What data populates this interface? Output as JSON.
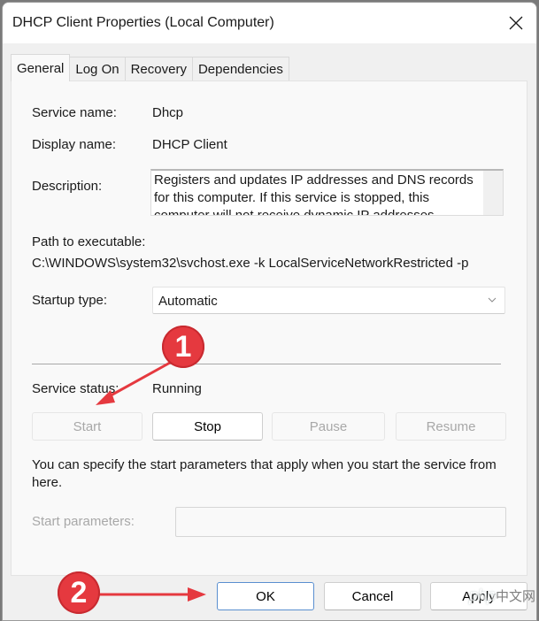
{
  "window": {
    "title": "DHCP Client Properties (Local Computer)"
  },
  "tabs": [
    {
      "label": "General",
      "active": true
    },
    {
      "label": "Log On",
      "active": false
    },
    {
      "label": "Recovery",
      "active": false
    },
    {
      "label": "Dependencies",
      "active": false
    }
  ],
  "general": {
    "service_name_label": "Service name:",
    "service_name_value": "Dhcp",
    "display_name_label": "Display name:",
    "display_name_value": "DHCP Client",
    "description_label": "Description:",
    "description_value": "Registers and updates IP addresses and DNS records for this computer. If this service is stopped, this computer will not receive dynamic IP addresses",
    "path_label": "Path to executable:",
    "path_value": "C:\\WINDOWS\\system32\\svchost.exe -k LocalServiceNetworkRestricted -p",
    "startup_type_label": "Startup type:",
    "startup_type_value": "Automatic",
    "service_status_label": "Service status:",
    "service_status_value": "Running",
    "buttons": {
      "start": "Start",
      "stop": "Stop",
      "pause": "Pause",
      "resume": "Resume"
    },
    "info_text": "You can specify the start parameters that apply when you start the service from here.",
    "start_params_label": "Start parameters:",
    "start_params_value": ""
  },
  "footer": {
    "ok": "OK",
    "cancel": "Cancel",
    "apply": "Apply"
  },
  "annotations": {
    "badge_1": "1",
    "badge_2": "2",
    "color": "#e5393f"
  },
  "watermark": {
    "brand": "php",
    "text": "中文网"
  }
}
